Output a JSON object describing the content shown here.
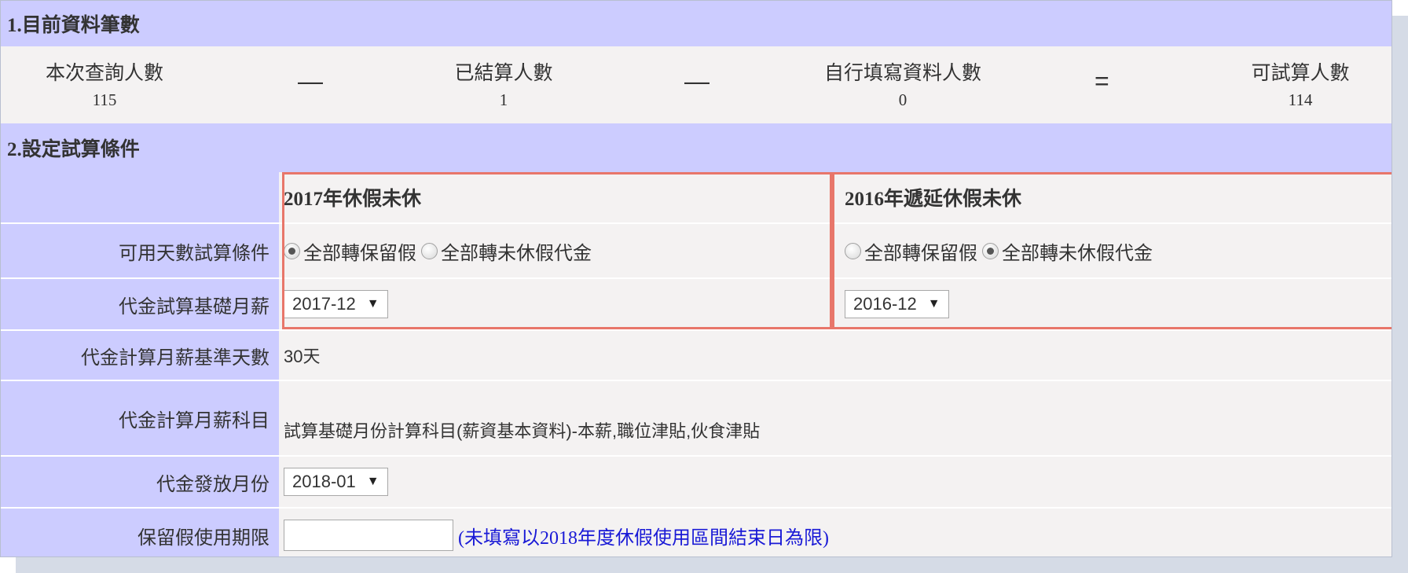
{
  "section1": {
    "title": "1.目前資料筆數",
    "items": [
      {
        "label": "本次查詢人數",
        "value": "115"
      },
      {
        "label": "已結算人數",
        "value": "1"
      },
      {
        "label": "自行填寫資料人數",
        "value": "0"
      },
      {
        "label": "可試算人數",
        "value": "114"
      }
    ],
    "operators": [
      "—",
      "—",
      "="
    ]
  },
  "section2": {
    "title": "2.設定試算條件",
    "colA_title": "2017年休假未休",
    "colB_title": "2016年遞延休假未休",
    "rows": {
      "available_days": {
        "label": "可用天數試算條件",
        "option_keep": "全部轉保留假",
        "option_cash": "全部轉未休假代金",
        "colA_selected": "全部轉保留假",
        "colB_selected": "全部轉未休假代金"
      },
      "base_salary": {
        "label": "代金試算基礎月薪",
        "colA_value": "2017-12",
        "colB_value": "2016-12",
        "arrow": "▼"
      },
      "base_days": {
        "label": "代金計算月薪基準天數",
        "value": "30天"
      },
      "salary_items": {
        "label": "代金計算月薪科目",
        "value": "試算基礎月份計算科目(薪資基本資料)-本薪,職位津貼,伙食津貼"
      },
      "pay_month": {
        "label": "代金發放月份",
        "value": "2018-01",
        "arrow": "▼"
      },
      "leave_deadline": {
        "label": "保留假使用期限",
        "input_value": "",
        "hint": "(未填寫以2018年度休假使用區間結束日為限)"
      }
    }
  },
  "colors": {
    "header_bg": "#ccccff",
    "row_bg": "#f4f2f2",
    "highlight_border": "#e8766a",
    "hint_text": "#1a1ad6"
  }
}
